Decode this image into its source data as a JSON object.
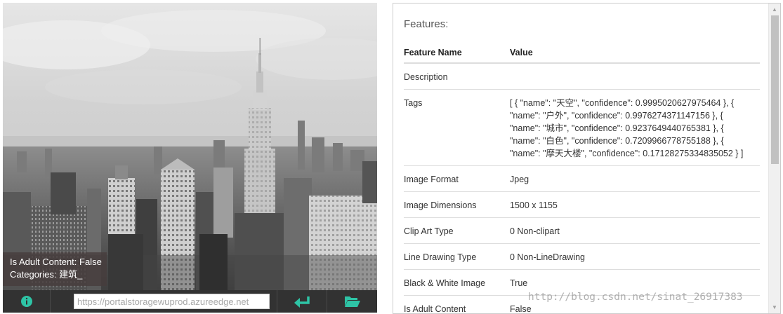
{
  "image_panel": {
    "overlay": {
      "adult_text": "Is Adult Content: False",
      "categories_text": "Categories: 建筑_"
    },
    "toolbar": {
      "url_placeholder": "https://portalstoragewuprod.azureedge.net",
      "icons": {
        "info": "info-icon",
        "enter": "enter-icon",
        "open": "folder-open-icon"
      },
      "accent_color": "#2ec4a6"
    }
  },
  "features": {
    "title": "Features:",
    "columns": [
      "Feature Name",
      "Value"
    ],
    "rows": [
      {
        "name": "Description",
        "value": ""
      },
      {
        "name": "Tags",
        "value_lines": [
          "[ { \"name\": \"天空\", \"confidence\": 0.9995020627975464 }, {",
          "\"name\": \"户外\", \"confidence\": 0.9976274371147156 }, {",
          "\"name\": \"城市\", \"confidence\": 0.9237649440765381 }, {",
          "\"name\": \"白色\", \"confidence\": 0.7209966778755188 }, {",
          "\"name\": \"摩天大楼\", \"confidence\": 0.17128275334835052 } ]"
        ]
      },
      {
        "name": "Image Format",
        "value": "Jpeg"
      },
      {
        "name": "Image Dimensions",
        "value": "1500 x 1155"
      },
      {
        "name": "Clip Art Type",
        "value": "0 Non-clipart"
      },
      {
        "name": "Line Drawing Type",
        "value": "0 Non-LineDrawing"
      },
      {
        "name": "Black & White Image",
        "value": "True"
      },
      {
        "name": "Is Adult Content",
        "value": "False"
      }
    ]
  },
  "watermark": "http://blog.csdn.net/sinat_26917383"
}
